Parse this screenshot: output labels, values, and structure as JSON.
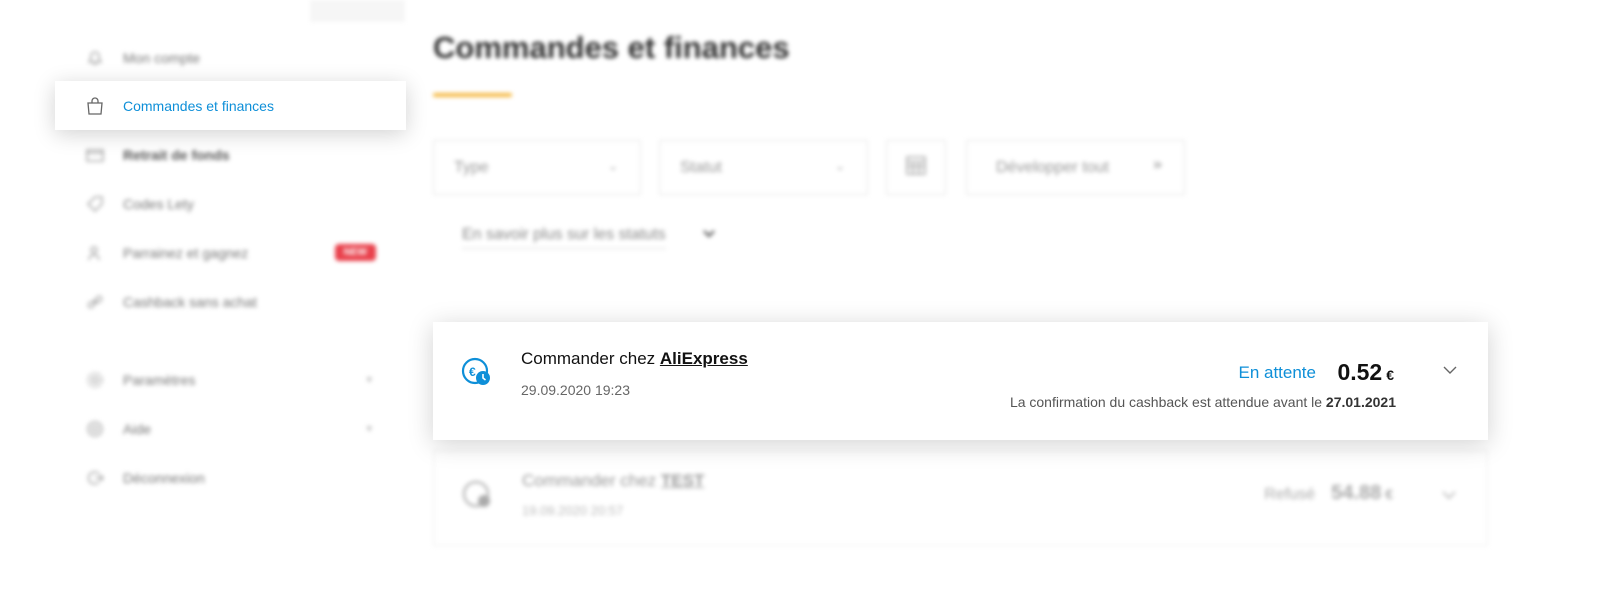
{
  "sidebar": {
    "items": [
      {
        "label": "Mon compte",
        "icon": "user-icon"
      },
      {
        "label": "Commandes et finances",
        "icon": "shopping-bag-icon"
      },
      {
        "label": "Retrait de fonds",
        "icon": "wallet-icon"
      },
      {
        "label": "Codes Lety",
        "icon": "tag-icon"
      },
      {
        "label": "Parrainez et gagnez",
        "icon": "referral-icon",
        "badge": "NEW"
      },
      {
        "label": "Cashback sans achat",
        "icon": "link-icon"
      },
      {
        "label": "Paramètres",
        "icon": "gear-icon"
      },
      {
        "label": "Aide",
        "icon": "help-icon"
      },
      {
        "label": "Déconnexion",
        "icon": "logout-icon"
      }
    ]
  },
  "main": {
    "title": "Commandes et finances",
    "filters": {
      "type": "Type",
      "status": "Statut",
      "expand_all": "Développer tout"
    },
    "learn_more": "En savoir plus sur les statuts"
  },
  "orders": [
    {
      "prefix": "Commander chez",
      "store": "AliExpress",
      "date": "29.09.2020 19:23",
      "status": "En attente",
      "amount": "0.52",
      "currency": "€",
      "confirmation_text": "La confirmation du cashback est attendue avant le",
      "confirmation_date": "27.01.2021"
    },
    {
      "prefix": "Commander chez",
      "store": "TEST",
      "date": "19.09.2020 20:57",
      "status": "Refusé",
      "amount": "54.88",
      "currency": "€"
    }
  ],
  "colors": {
    "accent": "#0e8fd8",
    "underline": "#f5b942",
    "badge": "#e9414c"
  }
}
